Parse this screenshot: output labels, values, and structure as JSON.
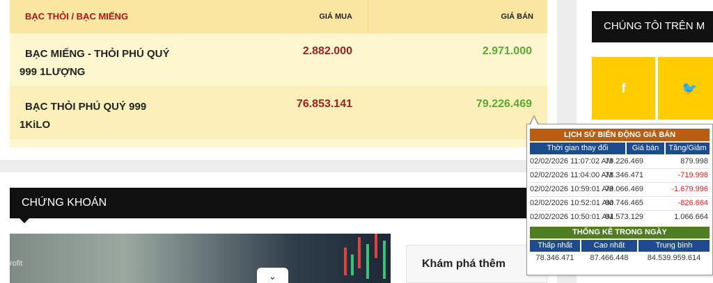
{
  "price_table": {
    "header": {
      "name": "BẠC THỎI / BẠC MIẾNG",
      "buy": "GIÁ MUA",
      "sell": "GIÁ BÁN"
    },
    "rows": [
      {
        "name": "BẠC MIẾNG - THỎI PHÚ QUÝ 999 1LƯỢNG",
        "buy": "2.882.000",
        "sell": "2.971.000"
      },
      {
        "name": "BẠC THỎI PHÚ QUÝ 999 1KiLO",
        "buy": "76.853.141",
        "sell": "79.226.469"
      }
    ]
  },
  "sidebar": {
    "title": "CHÚNG TÔI TRÊN M",
    "social": [
      {
        "icon": "facebook-icon",
        "glyph": "f"
      },
      {
        "icon": "twitter-icon",
        "glyph": "🐦"
      }
    ]
  },
  "stocks": {
    "title": "CHỨNG KHOÁN",
    "image_label": "rofit",
    "chevron": "⌄",
    "explore": "Khám phá thêm"
  },
  "tooltip": {
    "title": "LỊCH SỬ BIẾN ĐỘNG GIÁ BÁN",
    "headers": {
      "time": "Thời gian thay đổi",
      "price": "Giá bán",
      "change": "Tăng/Giảm"
    },
    "rows": [
      {
        "time": "02/02/2026 11:07:02 AM",
        "price": "79.226.469",
        "change": "879.998",
        "negative": false
      },
      {
        "time": "02/02/2026 11:04:00 AM",
        "price": "78.346.471",
        "change": "-719.998",
        "negative": true
      },
      {
        "time": "02/02/2026 10:59:01 AM",
        "price": "79.066.469",
        "change": "-1.679.996",
        "negative": true
      },
      {
        "time": "02/02/2026 10:52:01 AM",
        "price": "80.746.465",
        "change": "-826.664",
        "negative": true
      },
      {
        "time": "02/02/2026 10:50:01 AM",
        "price": "81.573.129",
        "change": "1.066.664",
        "negative": false
      }
    ],
    "stats": {
      "title": "THỐNG KÊ TRONG NGÀY",
      "headers": {
        "min": "Thấp nhất",
        "max": "Cao nhất",
        "avg": "Trung bình"
      },
      "values": {
        "min": "78.346.471",
        "max": "87.466.448",
        "avg": "84.539.959.614"
      }
    }
  },
  "colors": {
    "header_red": "#b5121b",
    "buy_red": "#9b1f1f",
    "sell_green": "#5aa832",
    "tooltip_orange": "#b85e14",
    "tooltip_blue": "#1e4a8e",
    "tooltip_green": "#4f7d22",
    "social_yellow": "#ffcc00"
  }
}
